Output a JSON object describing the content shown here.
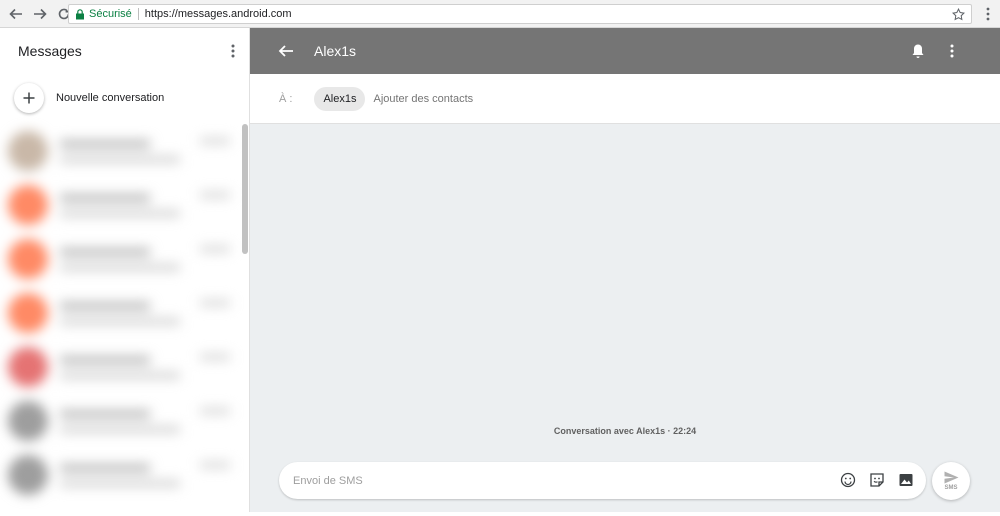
{
  "browser": {
    "secure_label": "Sécurisé",
    "url": "https://messages.android.com"
  },
  "sidebar": {
    "title": "Messages",
    "new_conversation_label": "Nouvelle conversation",
    "conversations": [
      {
        "avatar_color": "#c9b8a8"
      },
      {
        "avatar_color": "#ff8a65"
      },
      {
        "avatar_color": "#ff8a65"
      },
      {
        "avatar_color": "#ff8a65"
      },
      {
        "avatar_color": "#e57373"
      },
      {
        "avatar_color": "#9e9e9e"
      },
      {
        "avatar_color": "#9e9e9e"
      }
    ]
  },
  "conversation": {
    "title": "Alex1s",
    "to_label": "À :",
    "recipient_chip": "Alex1s",
    "add_contacts_placeholder": "Ajouter des contacts",
    "info_text": "Conversation avec Alex1s · 22:24"
  },
  "compose": {
    "placeholder": "Envoi de SMS",
    "send_label": "SMS"
  },
  "colors": {
    "app_bar": "#757575",
    "conversation_bg": "#eceff1",
    "secure_green": "#0b8043"
  }
}
